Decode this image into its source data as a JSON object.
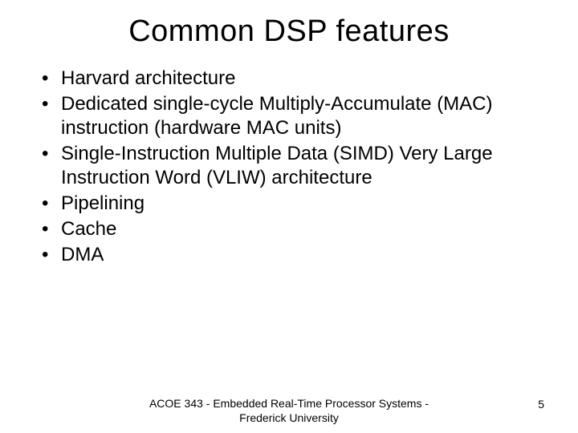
{
  "title": "Common DSP features",
  "bullets": [
    "Harvard architecture",
    "Dedicated single-cycle Multiply-Accumulate (MAC) instruction (hardware MAC units)",
    "Single-Instruction Multiple Data (SIMD) Very Large Instruction Word (VLIW) architecture",
    "Pipelining",
    "Cache",
    "DMA"
  ],
  "footer": "ACOE 343 - Embedded Real-Time Processor Systems - Frederick University",
  "page_number": "5"
}
